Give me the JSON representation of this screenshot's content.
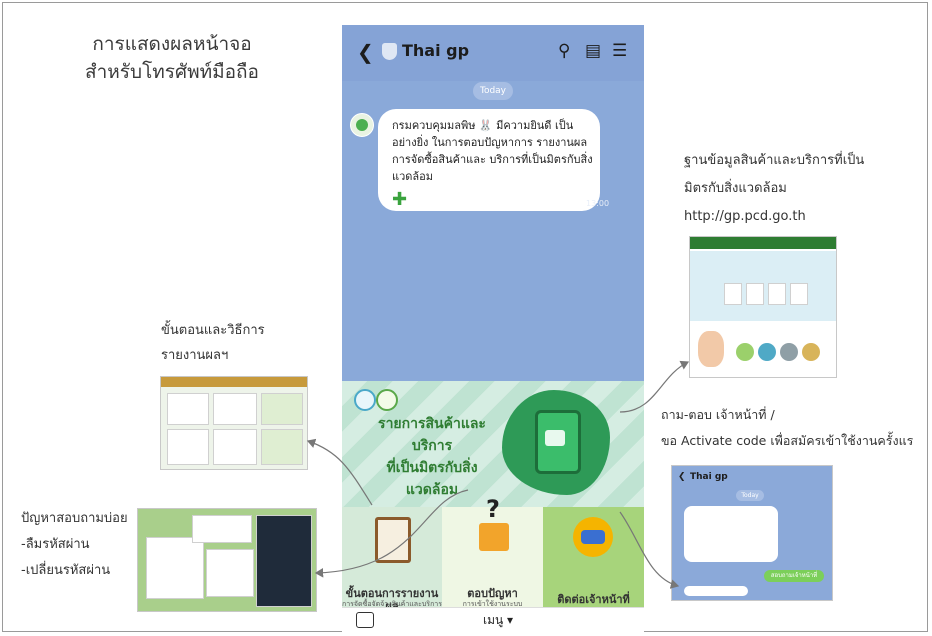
{
  "heading": {
    "line1": "การแสดงผลหน้าจอ",
    "line2": "สำหรับโทรศัพท์มือถือ"
  },
  "phone": {
    "title": "Thai gp",
    "today": "Today",
    "message_text": "กรมควบคุมมลพิษ 🐰 มีความยินดี เป็นอย่างยิ่ง ในการตอบปัญหาการ รายงานผลการจัดซื้อสินค้าและ บริการที่เป็นมิตรกับสิ่งแวดล้อม",
    "message_time": "13:00",
    "rich_menu": {
      "main_title_line1": "รายการสินค้าและบริการ",
      "main_title_line2": "ที่เป็นมิตรกับสิ่งแวดล้อม",
      "cell1_line1": "ขั้นตอนการรายงานผล",
      "cell1_line2": "การจัดซื้อจัดจ้างสินค้าและบริการ",
      "cell2_line1": "ตอบปัญหา",
      "cell2_line2": "การเข้าใช้งานระบบ",
      "cell3_line1": "ติดต่อเจ้าหน้าที่"
    },
    "menu_label": "เมนู ▾"
  },
  "labels": {
    "steps": [
      "ขั้นตอนและวิธีการ",
      "รายงานผลฯ"
    ],
    "faq": [
      "ปัญหาสอบถามบ่อย",
      "-ลืมรหัสผ่าน",
      "-เปลี่ยนรหัสผ่าน"
    ],
    "database": [
      "ฐานข้อมูลสินค้าและบริการที่เป็น",
      "มิตรกับสิ่งแวดล้อม",
      "http://gp.pcd.go.th"
    ],
    "contact": [
      "ถาม-ตอบ เจ้าหน้าที่ /",
      "ขอ Activate code เพื่อสมัครเข้าใช้งานครั้งแร"
    ]
  },
  "thumb_chat": {
    "title": "Thai gp",
    "today": "Today",
    "reply": "สอบถามเจ้าหน้าที่"
  },
  "colors": {
    "chat_bg": "#8aa9d9",
    "green_dark": "#2e9a57",
    "green_light": "#a7d47b"
  }
}
